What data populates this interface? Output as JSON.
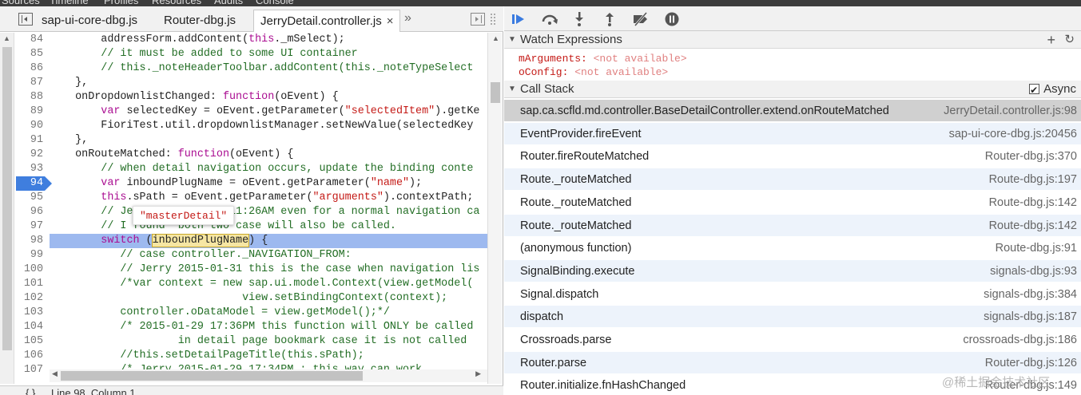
{
  "topbar_items": [
    "Sources",
    "Timeline",
    "Profiles",
    "Resources",
    "Audits",
    "Console"
  ],
  "tabs": [
    {
      "label": "sap-ui-core-dbg.js",
      "active": false
    },
    {
      "label": "Router-dbg.js",
      "active": false
    },
    {
      "label": "JerryDetail.controller.js",
      "active": true
    }
  ],
  "tab_close": "×",
  "tab_overflow": "»",
  "code_lines": [
    {
      "num": "84",
      "segs": [
        {
          "t": "        addressForm.addContent("
        },
        {
          "t": "this",
          "c": "kw"
        },
        {
          "t": "._mSelect);"
        }
      ]
    },
    {
      "num": "85",
      "segs": [
        {
          "t": "        // it must be added to some UI container",
          "c": "cm"
        }
      ]
    },
    {
      "num": "86",
      "segs": [
        {
          "t": "        // this._noteHeaderToolbar.addContent(this._noteTypeSelect",
          "c": "cm"
        }
      ]
    },
    {
      "num": "87",
      "segs": [
        {
          "t": "    },"
        }
      ]
    },
    {
      "num": "88",
      "segs": [
        {
          "t": "    onDropdownlistChanged: "
        },
        {
          "t": "function",
          "c": "kw"
        },
        {
          "t": "(oEvent) {"
        }
      ]
    },
    {
      "num": "89",
      "segs": [
        {
          "t": "        "
        },
        {
          "t": "var",
          "c": "kw"
        },
        {
          "t": " selectedKey = oEvent.getParameter("
        },
        {
          "t": "\"selectedItem\"",
          "c": "str"
        },
        {
          "t": ").getKe"
        }
      ]
    },
    {
      "num": "90",
      "segs": [
        {
          "t": "        FioriTest.util.dropdownlistManager.setNewValue(selectedKey"
        }
      ]
    },
    {
      "num": "91",
      "segs": [
        {
          "t": "    },"
        }
      ]
    },
    {
      "num": "92",
      "segs": [
        {
          "t": "    onRouteMatched: "
        },
        {
          "t": "function",
          "c": "kw"
        },
        {
          "t": "(oEvent) {"
        }
      ]
    },
    {
      "num": "93",
      "segs": [
        {
          "t": "        // when detail navigation occurs, update the binding conte",
          "c": "cm"
        }
      ]
    },
    {
      "num": "94",
      "bp": true,
      "segs": [
        {
          "t": "        "
        },
        {
          "t": "var",
          "c": "kw"
        },
        {
          "t": " inboundPlugName = oEvent.getParameter("
        },
        {
          "t": "\"name\"",
          "c": "str"
        },
        {
          "t": ");"
        }
      ]
    },
    {
      "num": "95",
      "segs": [
        {
          "t": "        "
        },
        {
          "t": "this",
          "c": "kw"
        },
        {
          "t": ".sPath = oEvent.getParameter("
        },
        {
          "t": "\"arguments\"",
          "c": "str"
        },
        {
          "t": ").contextPath;"
        }
      ]
    },
    {
      "num": "96",
      "segs": [
        {
          "t": "        // Jerry 2015-01-31 11:26AM even for a normal navigation ca",
          "c": "cm"
        }
      ]
    },
    {
      "num": "97",
      "segs": [
        {
          "t": "        // I found  both two case will also be called.",
          "c": "cm"
        }
      ]
    },
    {
      "num": "98",
      "current": true,
      "segs": [
        {
          "t": "        "
        },
        {
          "t": "switch",
          "c": "kw"
        },
        {
          "t": " ("
        },
        {
          "t": "inboundPlugName",
          "c": "hl"
        },
        {
          "t": ") {"
        }
      ]
    },
    {
      "num": "99",
      "segs": [
        {
          "t": "           // case controller._NAVIGATION_FROM:",
          "c": "cm"
        }
      ]
    },
    {
      "num": "100",
      "segs": [
        {
          "t": "           // Jerry 2015-01-31 this is the case when navigation lis",
          "c": "cm"
        }
      ]
    },
    {
      "num": "101",
      "segs": [
        {
          "t": "           /*var context = new sap.ui.model.Context(view.getModel(",
          "c": "cm"
        }
      ]
    },
    {
      "num": "102",
      "segs": [
        {
          "t": "                              view.setBindingContext(context);",
          "c": "cm"
        }
      ]
    },
    {
      "num": "103",
      "segs": [
        {
          "t": "           controller.oDataModel = view.getModel();*/",
          "c": "cm"
        }
      ]
    },
    {
      "num": "104",
      "segs": [
        {
          "t": "           /* 2015-01-29 17:36PM this function will ONLY be called",
          "c": "cm"
        }
      ]
    },
    {
      "num": "105",
      "segs": [
        {
          "t": "                    in detail page bookmark case it is not called ",
          "c": "cm"
        }
      ]
    },
    {
      "num": "106",
      "segs": [
        {
          "t": "           //this.setDetailPageTitle(this.sPath);",
          "c": "cm"
        }
      ]
    },
    {
      "num": "107",
      "segs": [
        {
          "t": "           /* Jerry 2015-01-29 17:34PM : this way can work",
          "c": "cm"
        }
      ]
    }
  ],
  "popover_value": "\"masterDetail\"",
  "status": {
    "braces": "{ }",
    "position": "Line 98, Column 1"
  },
  "watch": {
    "title": "Watch Expressions",
    "items": [
      {
        "name": "mArguments",
        "value": "<not available>"
      },
      {
        "name": "oConfig",
        "value": "<not available>"
      }
    ]
  },
  "callstack": {
    "title": "Call Stack",
    "async_label": "Async",
    "async_checked": true,
    "frames": [
      {
        "fn": "sap.ca.scfld.md.controller.BaseDetailController.extend.onRouteMatched",
        "loc": "JerryDetail.controller.js:98"
      },
      {
        "fn": "EventProvider.fireEvent",
        "loc": "sap-ui-core-dbg.js:20456"
      },
      {
        "fn": "Router.fireRouteMatched",
        "loc": "Router-dbg.js:370"
      },
      {
        "fn": "Route._routeMatched",
        "loc": "Route-dbg.js:197"
      },
      {
        "fn": "Route._routeMatched",
        "loc": "Route-dbg.js:142"
      },
      {
        "fn": "Route._routeMatched",
        "loc": "Route-dbg.js:142"
      },
      {
        "fn": "(anonymous function)",
        "loc": "Route-dbg.js:91"
      },
      {
        "fn": "SignalBinding.execute",
        "loc": "signals-dbg.js:93"
      },
      {
        "fn": "Signal.dispatch",
        "loc": "signals-dbg.js:384"
      },
      {
        "fn": "dispatch",
        "loc": "signals-dbg.js:187"
      },
      {
        "fn": "Crossroads.parse",
        "loc": "crossroads-dbg.js:186"
      },
      {
        "fn": "Router.parse",
        "loc": "Router-dbg.js:126"
      },
      {
        "fn": "Router.initialize.fnHashChanged",
        "loc": "Router-dbg.js:149"
      }
    ]
  },
  "watermark": "@稀土掘金技术社区",
  "icons": {
    "resume": "resume-icon",
    "step_over": "step-over-icon",
    "step_into": "step-into-icon",
    "step_out": "step-out-icon",
    "deactivate": "deactivate-breakpoints-icon",
    "pause_exceptions": "pause-on-exceptions-icon",
    "add": "add-icon",
    "refresh": "refresh-icon"
  }
}
